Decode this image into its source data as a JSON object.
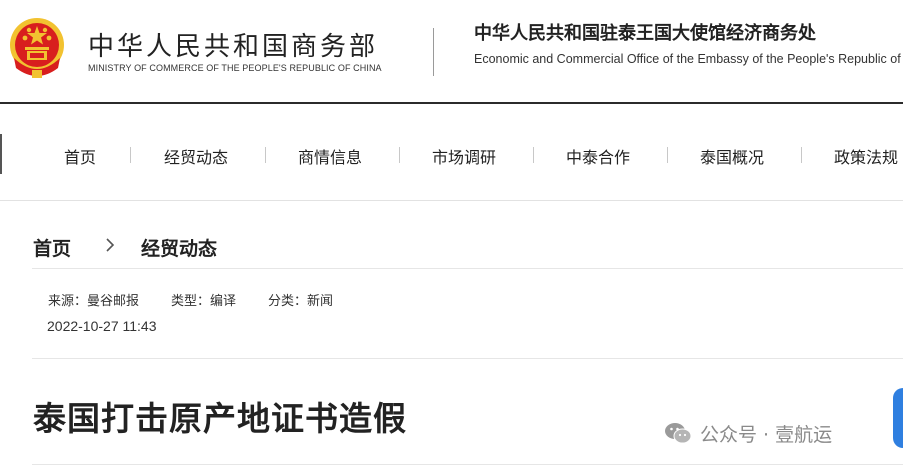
{
  "header": {
    "ministry_cn": "中华人民共和国商务部",
    "ministry_en": "MINISTRY OF COMMERCE OF THE PEOPLE'S REPUBLIC OF CHINA",
    "office_cn": "中华人民共和国驻泰王国大使馆经济商务处",
    "office_en": "Economic and Commercial Office of the Embassy of the People's Republic of"
  },
  "nav": {
    "items": [
      {
        "label": "首页"
      },
      {
        "label": "经贸动态"
      },
      {
        "label": "商情信息"
      },
      {
        "label": "市场调研"
      },
      {
        "label": "中泰合作"
      },
      {
        "label": "泰国概况"
      },
      {
        "label": "政策法规"
      }
    ]
  },
  "breadcrumb": {
    "home": "首页",
    "current": "经贸动态"
  },
  "meta": {
    "source": "来源：曼谷邮报",
    "type": "类型：编译",
    "category": "分类：新闻",
    "date": "2022-10-27 11:43"
  },
  "article": {
    "title": "泰国打击原产地证书造假"
  },
  "watermark": {
    "text": "公众号 · 壹航运",
    "icon": "wechat-icon"
  },
  "colors": {
    "emblem_red": "#d81e1e",
    "emblem_gold": "#f2c230",
    "rule_dark": "#2b2b2b",
    "accent_blue": "#2f7fe0"
  }
}
